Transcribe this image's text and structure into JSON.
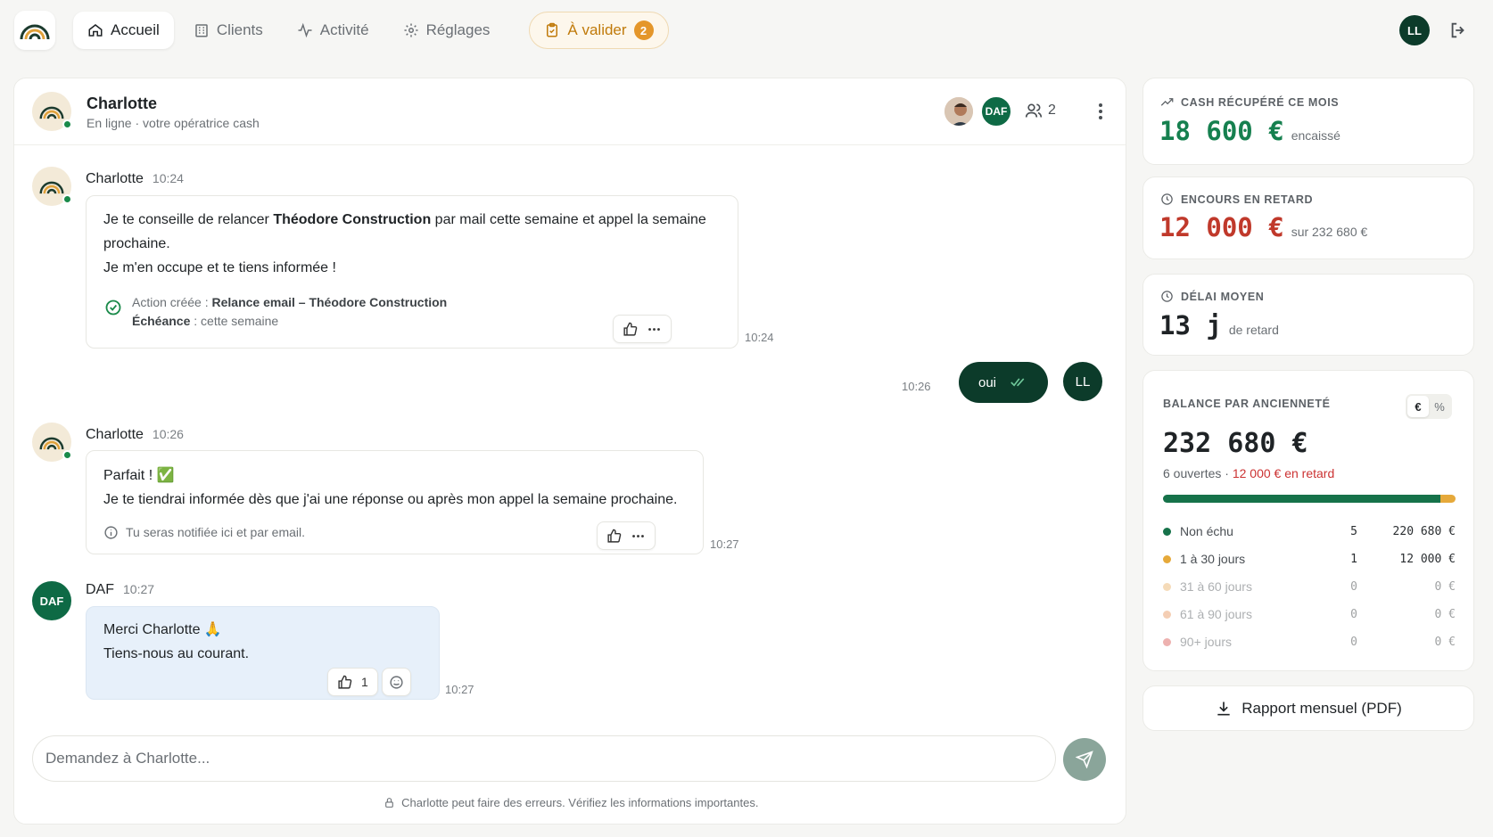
{
  "nav": {
    "items": [
      {
        "label": "Accueil",
        "icon": "home-icon",
        "active": true
      },
      {
        "label": "Clients",
        "icon": "building-icon",
        "active": false
      },
      {
        "label": "Activité",
        "icon": "activity-icon",
        "active": false
      },
      {
        "label": "Réglages",
        "icon": "gear-icon",
        "active": false
      }
    ],
    "validate_label": "À valider",
    "validate_count": "2",
    "user_initials": "LL"
  },
  "chat": {
    "header": {
      "name": "Charlotte",
      "subtitle": "En ligne · votre opératrice cash",
      "daf_badge": "DAF",
      "member_count": "2"
    },
    "messages": [
      {
        "author": "Charlotte",
        "time": "10:24",
        "text_before": "Je te conseille de relancer ",
        "text_bold": "Théodore Construction",
        "text_after": " par mail cette semaine et appel la semaine prochaine.",
        "text_line2": "Je m'en occupe et te tiens informée !",
        "action_label": "Action créée : ",
        "action_value": "Relance email – Théodore Construction",
        "due_label": "Échéance",
        "due_value": " : cette semaine",
        "sent_time": "10:24"
      },
      {
        "author": "LL",
        "text": "oui",
        "time": "10:26"
      },
      {
        "author": "Charlotte",
        "time": "10:26",
        "line1": "Parfait ! ✅",
        "line2": "Je te tiendrai informée dès que j'ai une réponse ou après mon appel la semaine prochaine.",
        "note": "Tu seras notifiée ici et par email.",
        "sent_time": "10:27"
      },
      {
        "author": "DAF",
        "time": "10:27",
        "line1": "Merci Charlotte 🙏",
        "line2": "Tiens-nous au courant.",
        "like_count": "1",
        "sent_time": "10:27"
      }
    ],
    "input_placeholder": "Demandez à Charlotte...",
    "disclaimer": "Charlotte peut faire des erreurs. Vérifiez les informations importantes."
  },
  "kpis": {
    "cash": {
      "label": "CASH RÉCUPÉRÉ CE MOIS",
      "value": "18 600 €",
      "unit": "encaissé",
      "color": "#16804f"
    },
    "overdue": {
      "label": "ENCOURS EN RETARD",
      "value": "12 000 €",
      "unit": "sur 232 680 €",
      "color": "#c0392b"
    },
    "delay": {
      "label": "DÉLAI MOYEN",
      "value": "13 j",
      "unit": "de retard",
      "color": "#1f2326"
    }
  },
  "balance": {
    "title": "BALANCE PAR ANCIENNETÉ",
    "toggle_eur": "€",
    "toggle_pct": "%",
    "total": "232 680 €",
    "open_count": "6 ouvertes · ",
    "overdue_text": "12 000 € en retard",
    "bar": [
      {
        "fraction": 0.948,
        "color": "#16724a"
      },
      {
        "fraction": 0.052,
        "color": "#e6a93a"
      }
    ],
    "buckets": [
      {
        "name": "Non échu",
        "count": "5",
        "amount": "220 680 €",
        "color": "#16724a",
        "faded": false
      },
      {
        "name": "1 à 30 jours",
        "count": "1",
        "amount": "12 000 €",
        "color": "#e6a93a",
        "faded": false
      },
      {
        "name": "31 à 60 jours",
        "count": "0",
        "amount": "0 €",
        "color": "#eab065",
        "faded": true
      },
      {
        "name": "61 à 90 jours",
        "count": "0",
        "amount": "0 €",
        "color": "#e8955a",
        "faded": true
      },
      {
        "name": "90+ jours",
        "count": "0",
        "amount": "0 €",
        "color": "#d9534f",
        "faded": true
      }
    ]
  },
  "report_button": "Rapport mensuel (PDF)"
}
